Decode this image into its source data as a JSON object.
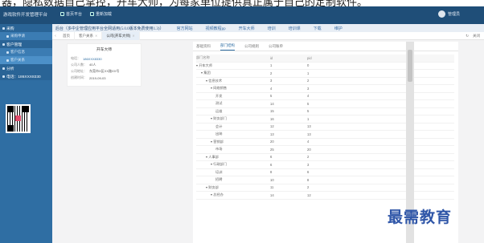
{
  "banner_text": "器，隐私数据自己掌控，开车大师，为每家单位提供真正属于自己的定制软件。",
  "topbar": {
    "brand": "游戏软件开发管理平台",
    "nav": [
      {
        "icon": "home-icon",
        "label": "首页平台"
      },
      {
        "icon": "reload-icon",
        "label": "重新加载"
      }
    ],
    "user_name": "管理员"
  },
  "sidebar": {
    "groups": [
      {
        "label": "采购",
        "items": [
          {
            "label": "采购申请",
            "active": false
          }
        ]
      },
      {
        "label": "客户管理",
        "items": [
          {
            "label": "客户信息",
            "active": false
          },
          {
            "label": "客户关系",
            "active": true
          }
        ]
      },
      {
        "label": "分析",
        "items": []
      }
    ],
    "phone": "电话：186XXX8330"
  },
  "ticker": [
    "后台（多中企管理应用平台全网适用(5.0.0版本免费使用1.3)）",
    "官方网站",
    "视频教程pp",
    "开车大师",
    "培训",
    "培训课",
    "下载",
    "维护"
  ],
  "page_tabs": [
    {
      "label": "首页",
      "active": false
    },
    {
      "label": "客户关系",
      "active": false
    },
    {
      "label": "公司(开车大师)",
      "active": true
    }
  ],
  "tabs_right": {
    "refresh": "↻",
    "close_all": "关闭"
  },
  "card": {
    "name": "开车大师",
    "rows": [
      {
        "label": "电话：",
        "value": "186XXX8330",
        "blue": true
      },
      {
        "label": "公司人数：",
        "value": "40人",
        "blue": false
      },
      {
        "label": "公司地址：",
        "value": "东莞市X区XX路XX号",
        "blue": false
      },
      {
        "label": "创建时间：",
        "value": "2019-09-03",
        "blue": false
      }
    ]
  },
  "panel_tabs": [
    {
      "label": "基础资料",
      "active": false
    },
    {
      "label": "部门结构",
      "active": true
    },
    {
      "label": "公司规则",
      "active": false
    },
    {
      "label": "公司账单",
      "active": false
    }
  ],
  "grid": {
    "headers": [
      "部门名称",
      "id",
      "pid"
    ],
    "rows": [
      {
        "name": "▾ 开车大师",
        "id": "1",
        "pid": "0",
        "indent": 0
      },
      {
        "name": "▾ 集团",
        "id": "2",
        "pid": "1",
        "indent": 1
      },
      {
        "name": "▾ 信息技术",
        "id": "3",
        "pid": "2",
        "indent": 2
      },
      {
        "name": "▾ 网络销售",
        "id": "4",
        "pid": "3",
        "indent": 3
      },
      {
        "name": "开发",
        "id": "5",
        "pid": "4",
        "indent": 4
      },
      {
        "name": "测试",
        "id": "14",
        "pid": "5",
        "indent": 4
      },
      {
        "name": "运维",
        "id": "15",
        "pid": "5",
        "indent": 4
      },
      {
        "name": "▾ 财务部门",
        "id": "16",
        "pid": "1",
        "indent": 3
      },
      {
        "name": "会计",
        "id": "12",
        "pid": "13",
        "indent": 4
      },
      {
        "name": "出纳",
        "id": "13",
        "pid": "13",
        "indent": 4
      },
      {
        "name": "▾ 营销部",
        "id": "20",
        "pid": "4",
        "indent": 3
      },
      {
        "name": "市场",
        "id": "25",
        "pid": "20",
        "indent": 4
      },
      {
        "name": "▾ 人事部",
        "id": "6",
        "pid": "2",
        "indent": 2
      },
      {
        "name": "▾ 行政部门",
        "id": "6",
        "pid": "3",
        "indent": 3
      },
      {
        "name": "培训",
        "id": "8",
        "pid": "6",
        "indent": 4
      },
      {
        "name": "招聘",
        "id": "10",
        "pid": "8",
        "indent": 4
      },
      {
        "name": "▾ 财务部",
        "id": "11",
        "pid": "2",
        "indent": 2
      },
      {
        "name": "▾ 总经办",
        "id": "14",
        "pid": "12",
        "indent": 3
      }
    ]
  },
  "watermark": "最需教育"
}
